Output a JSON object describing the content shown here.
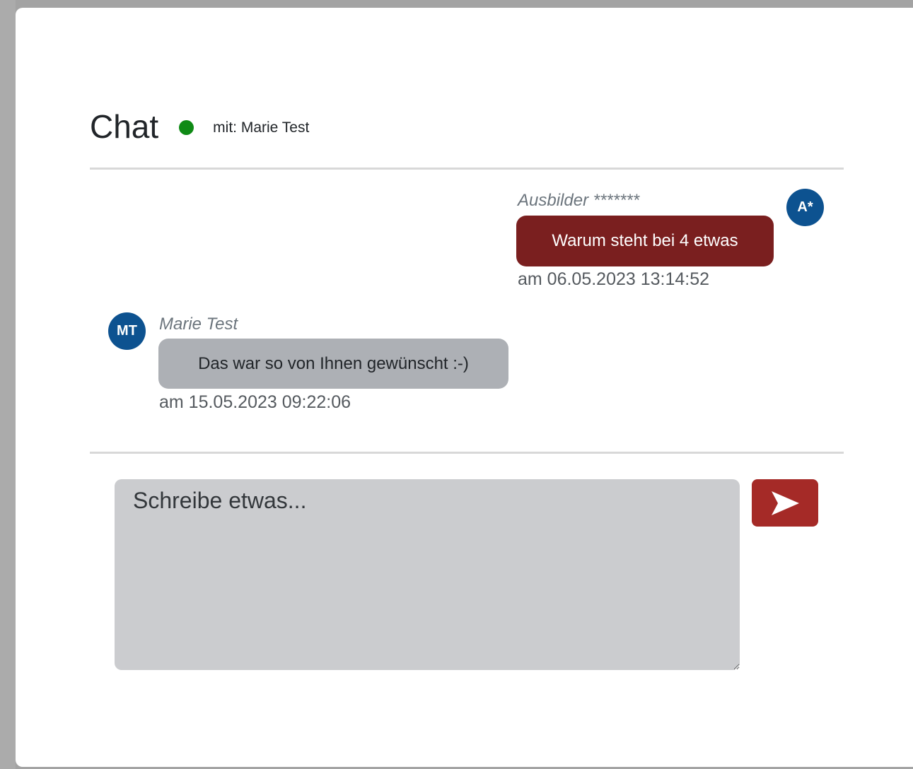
{
  "header": {
    "title": "Chat",
    "partner_label": "mit: Marie Test"
  },
  "messages": [
    {
      "avatar": "A*",
      "sender": "Ausbilder *******",
      "text": "Warum steht bei 4 etwas",
      "timestamp": "am 06.05.2023 13:14:52"
    },
    {
      "avatar": "MT",
      "sender": "Marie Test",
      "text": "Das war so von Ihnen gewünscht :-)",
      "timestamp": "am 15.05.2023 09:22:06"
    }
  ],
  "composer": {
    "placeholder": "Schreibe etwas...",
    "value": ""
  },
  "icons": {
    "status": "online-status-dot",
    "send": "send-arrow-icon"
  },
  "colors": {
    "online": "#0f8a15",
    "avatar": "#0d5290",
    "outgoing_bubble": "#7a1f1f",
    "incoming_bubble": "#adb0b5",
    "send_button": "#a52a27",
    "input_background": "#cbcccf"
  }
}
